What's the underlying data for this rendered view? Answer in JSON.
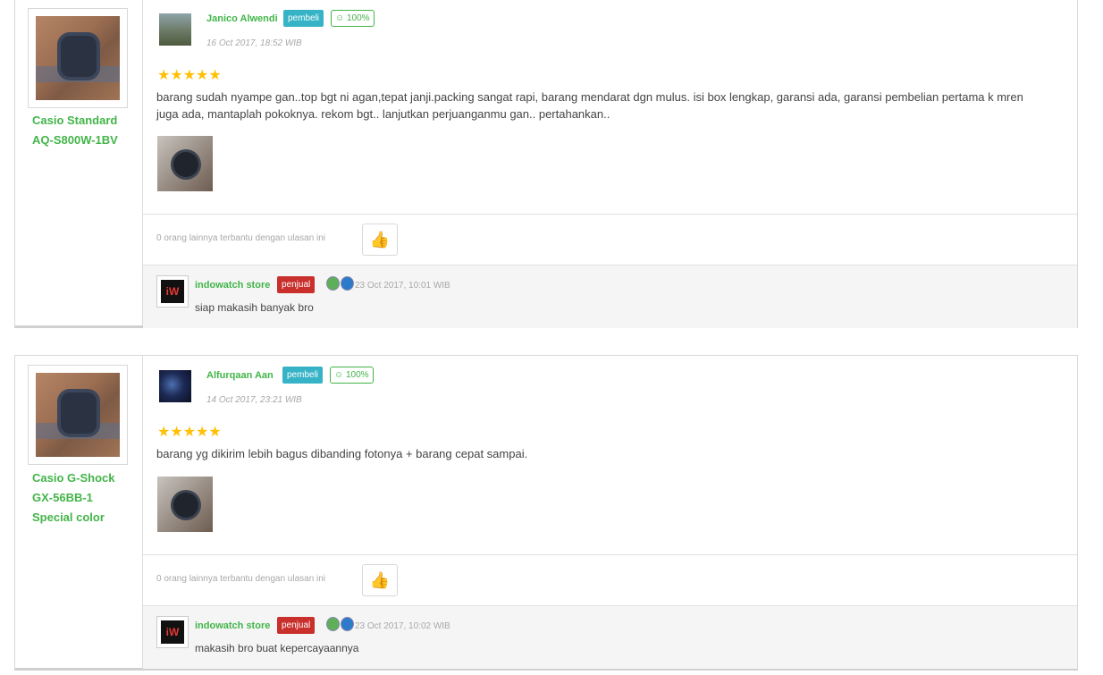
{
  "reviews": [
    {
      "product_name_lines": [
        "Casio Standard",
        "AQ-S800W-1BV"
      ],
      "reviewer": "Janico Alwendi",
      "buyer_badge": "pembeli",
      "rating_pct": "☺ 100%",
      "date": "16 Oct 2017, 18:52 WIB",
      "stars": "★★★★★",
      "rating": 5,
      "text": "barang sudah nyampe gan..top bgt ni agan,tepat janji.packing sangat rapi, barang mendarat dgn mulus. isi box lengkap, garansi ada, garansi pembelian pertama k mren juga ada, mantaplah pokoknya. rekom bgt.. lanjutkan perjuanganmu gan.. pertahankan..",
      "helpful_text": "0 orang lainnya terbantu dengan ulasan ini",
      "reply": {
        "store_name": "indowatch store",
        "seller_badge": "penjual",
        "date": "23 Oct 2017, 10:01 WIB",
        "text": "siap makasih banyak bro"
      }
    },
    {
      "product_name_lines": [
        "Casio G-Shock",
        "GX-56BB-1",
        "Special color"
      ],
      "reviewer": "Alfurqaan Aan",
      "buyer_badge": "pembeli",
      "rating_pct": "☺ 100%",
      "date": "14 Oct 2017, 23:21 WIB",
      "stars": "★★★★★",
      "rating": 5,
      "text": "barang yg dikirim lebih bagus dibanding fotonya + barang cepat sampai.",
      "helpful_text": "0 orang lainnya terbantu dengan ulasan ini",
      "reply": {
        "store_name": "indowatch store",
        "seller_badge": "penjual",
        "date": "23 Oct 2017, 10:02 WIB",
        "text": "makasih bro buat kepercayaannya"
      }
    }
  ],
  "icons": {
    "thumbs_up": "thumbs-up-icon",
    "store_logo_text": "iW"
  },
  "colors": {
    "green": "#42b549",
    "buyer_badge": "#36b3c6",
    "seller_badge": "#c9302c",
    "star": "#ffc107"
  }
}
